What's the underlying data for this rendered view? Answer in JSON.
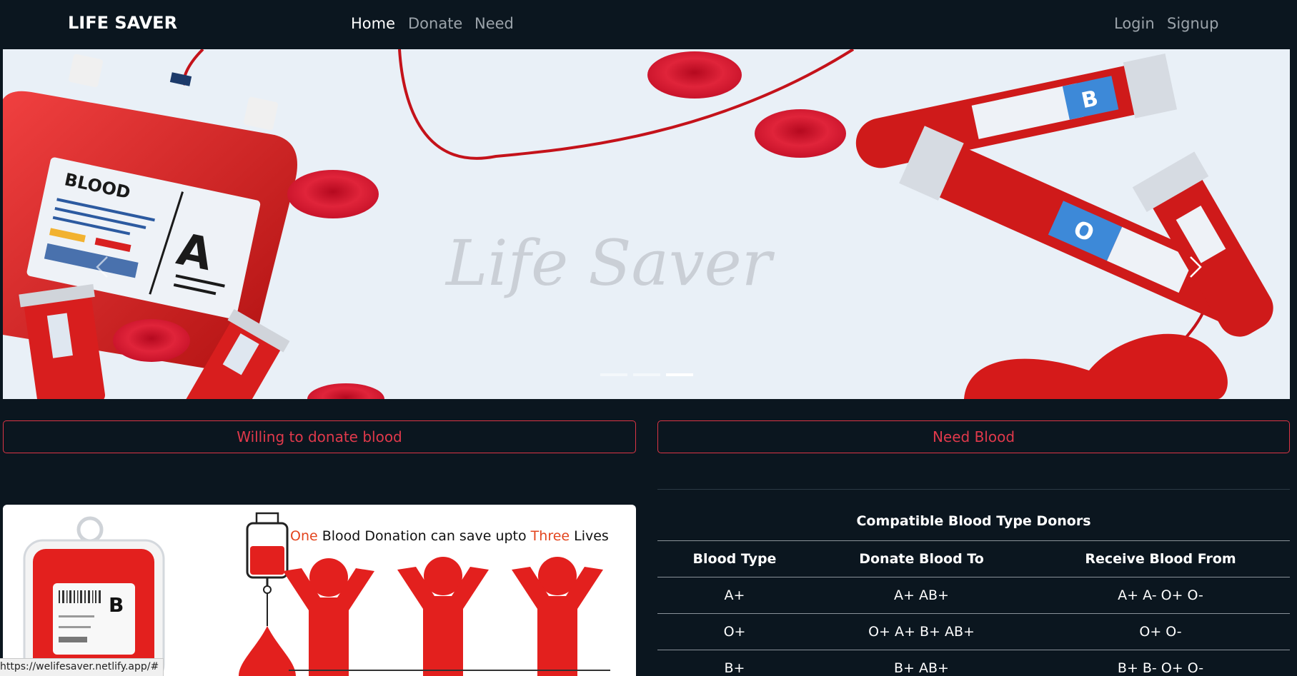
{
  "navbar": {
    "brand": "LIFE SAVER",
    "links": [
      {
        "label": "Home",
        "active": true
      },
      {
        "label": "Donate",
        "active": false
      },
      {
        "label": "Need",
        "active": false
      }
    ],
    "auth": [
      {
        "label": "Login"
      },
      {
        "label": "Signup"
      }
    ]
  },
  "hero": {
    "watermark": "Life Saver",
    "bag_text": "BLOOD",
    "bag_type": "A",
    "tube1_label": "B",
    "tube2_label": "O",
    "active_slide": 3,
    "slide_count": 3
  },
  "actions": {
    "donate_label": "Willing to donate blood",
    "need_label": "Need Blood"
  },
  "info_image": {
    "word_one": "One",
    "middle_text": " Blood Donation can save upto ",
    "word_three": "Three",
    "word_lives": " Lives",
    "bag_type": "B"
  },
  "compat_table": {
    "caption": "Compatible Blood Type Donors",
    "headers": [
      "Blood Type",
      "Donate Blood To",
      "Receive Blood From"
    ],
    "rows": [
      [
        "A+",
        "A+ AB+",
        "A+ A- O+ O-"
      ],
      [
        "O+",
        "O+ A+ B+ AB+",
        "O+ O-"
      ],
      [
        "B+",
        "B+ AB+",
        "B+ B- O+ O-"
      ]
    ]
  },
  "status_bar": {
    "url": "https://welifesaver.netlify.app/#"
  },
  "colors": {
    "background": "#0b161f",
    "accent_red": "#dc3545",
    "blood_red": "#e0201d",
    "hero_bg": "#e9f0f7"
  }
}
